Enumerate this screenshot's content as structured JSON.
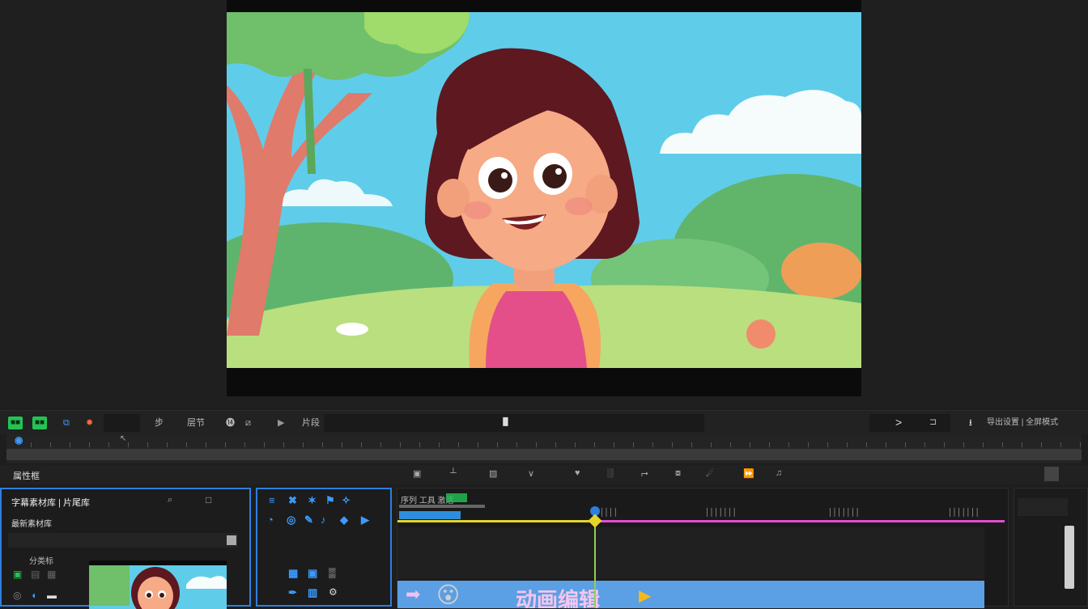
{
  "toolbar": {
    "btn1": "■■",
    "btn2": "■■",
    "label1": "步",
    "label2": "层节",
    "label3": "⓮",
    "label4": "片段",
    "center_mark": "▐▌",
    "play_icon": ">",
    "right_stop": "⊐",
    "export_label": "导出设置 | 全屏模式"
  },
  "ruler_row": {
    "label": "属性框"
  },
  "left_panel": {
    "title": "字幕素材库 | 片尾库",
    "subtitle": "最新素材库",
    "group_label": "分类标"
  },
  "timeline": {
    "header_label": "序列 工具 激活",
    "clip_title": "动画编辑",
    "clip_emoji": "😮",
    "ticks": [
      "││││",
      "│││││││",
      "│││││││",
      "│││││││"
    ]
  },
  "colors": {
    "accent_blue": "#2d7fe0",
    "accent_green": "#23c455",
    "playhead": "#e5d42a",
    "track_pink": "#e04fd2",
    "clip_blue": "#5b9fe4"
  }
}
